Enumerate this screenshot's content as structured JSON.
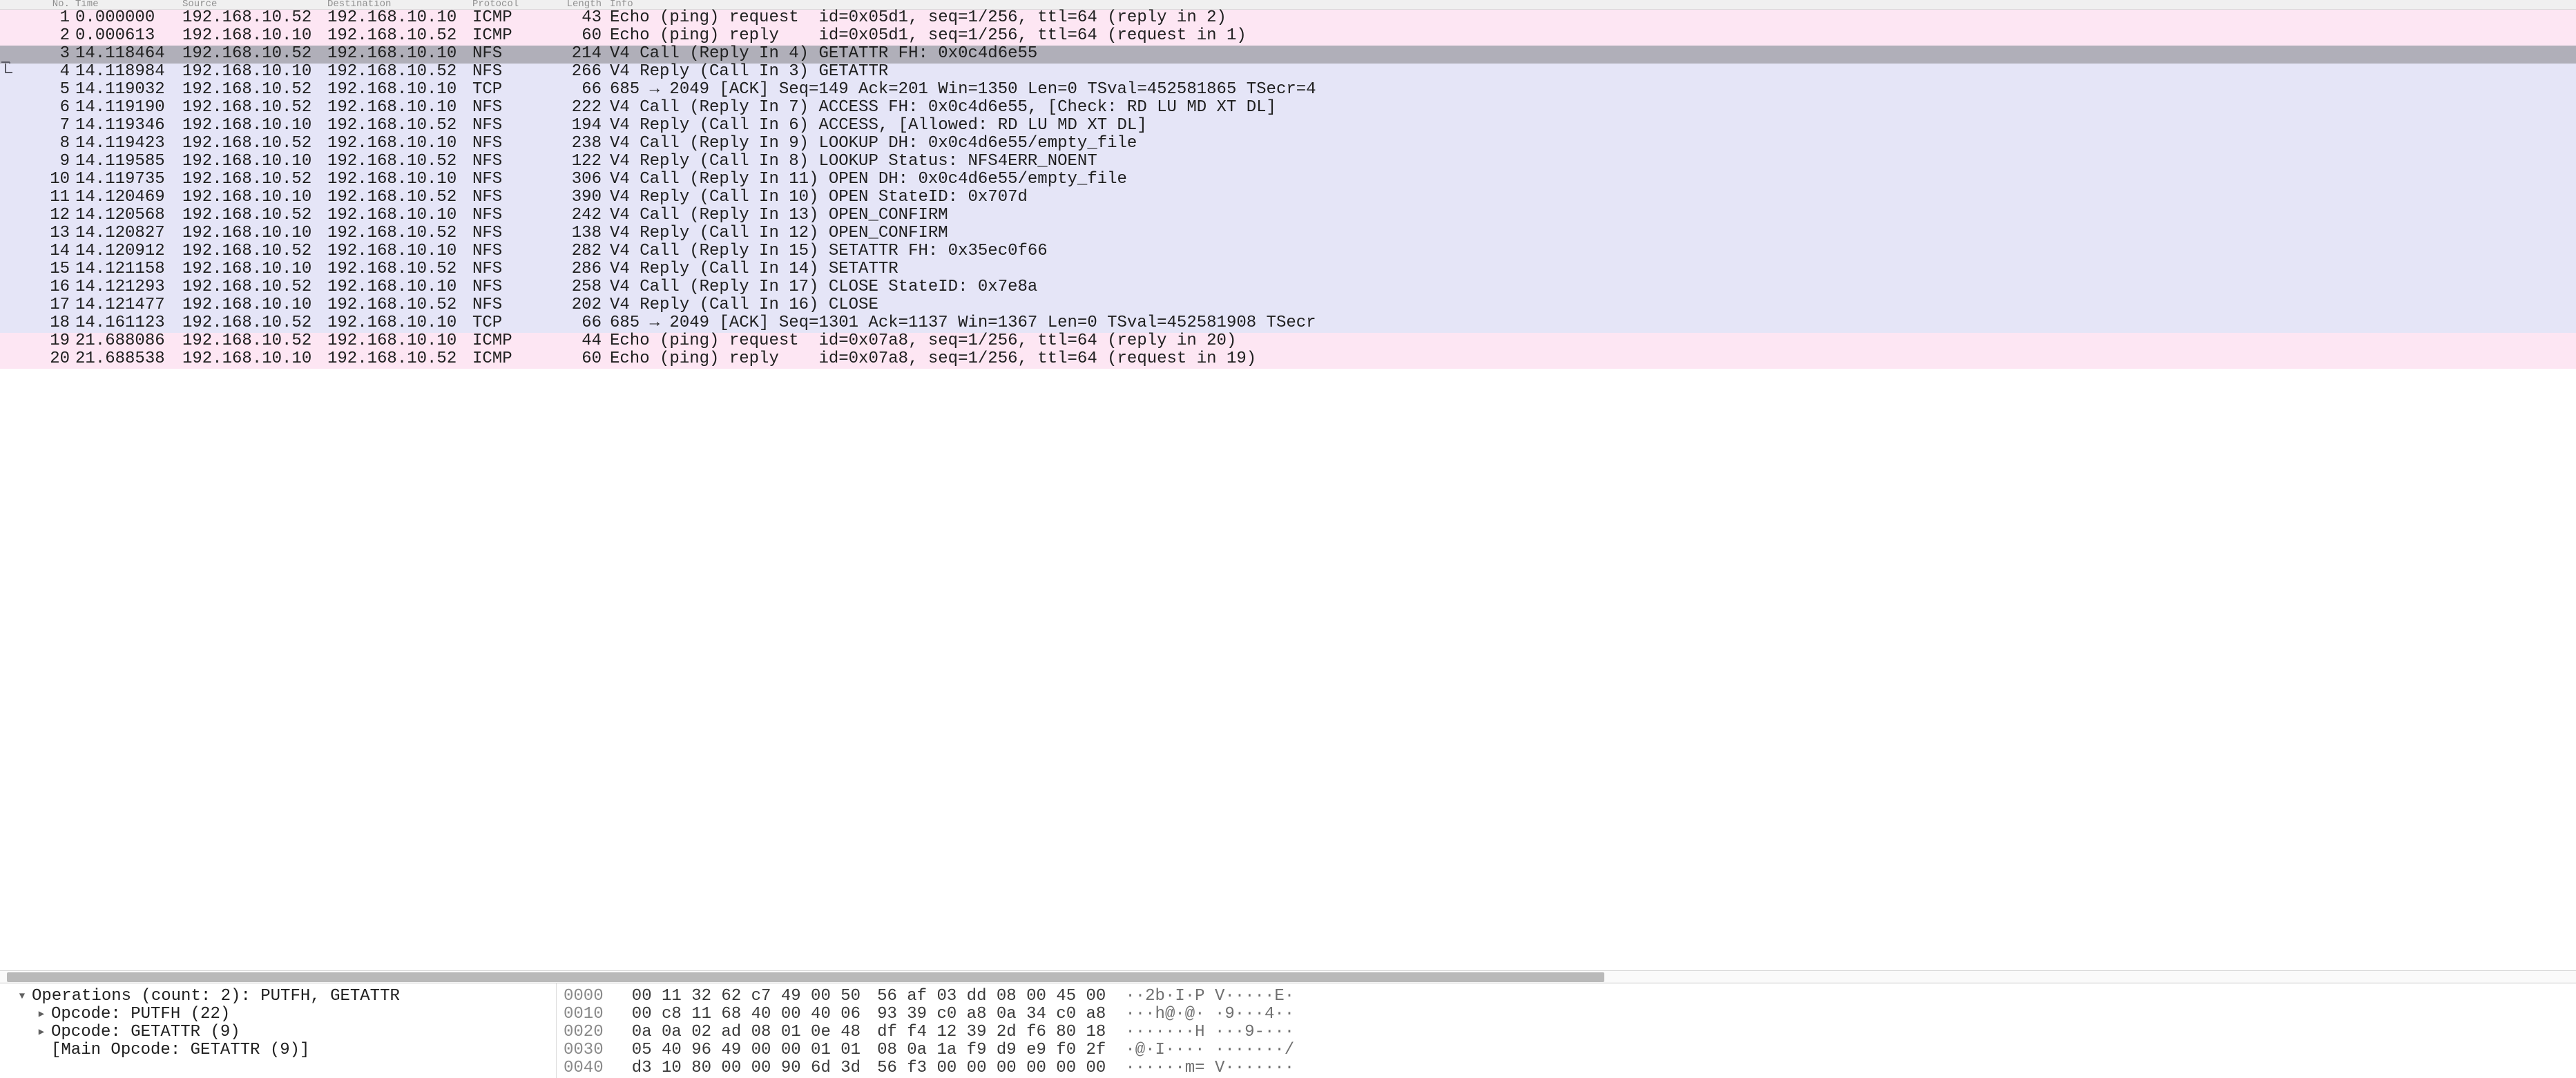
{
  "headers": {
    "no": "No.",
    "time": "Time",
    "source": "Source",
    "destination": "Destination",
    "protocol": "Protocol",
    "length": "Length",
    "info": "Info"
  },
  "selected_index": 2,
  "related_range_start": 3,
  "related_range_end": 17,
  "packets": [
    {
      "no": "1",
      "time": "0.000000",
      "src": "192.168.10.52",
      "dst": "192.168.10.10",
      "proto": "ICMP",
      "len": "43",
      "info": "Echo (ping) request  id=0x05d1, seq=1/256, ttl=64 (reply in 2)"
    },
    {
      "no": "2",
      "time": "0.000613",
      "src": "192.168.10.10",
      "dst": "192.168.10.52",
      "proto": "ICMP",
      "len": "60",
      "info": "Echo (ping) reply    id=0x05d1, seq=1/256, ttl=64 (request in 1)"
    },
    {
      "no": "3",
      "time": "14.118464",
      "src": "192.168.10.52",
      "dst": "192.168.10.10",
      "proto": "NFS",
      "len": "214",
      "info": "V4 Call (Reply In 4) GETATTR FH: 0x0c4d6e55"
    },
    {
      "no": "4",
      "time": "14.118984",
      "src": "192.168.10.10",
      "dst": "192.168.10.52",
      "proto": "NFS",
      "len": "266",
      "info": "V4 Reply (Call In 3) GETATTR"
    },
    {
      "no": "5",
      "time": "14.119032",
      "src": "192.168.10.52",
      "dst": "192.168.10.10",
      "proto": "TCP",
      "len": "66",
      "info": "685 → 2049 [ACK] Seq=149 Ack=201 Win=1350 Len=0 TSval=452581865 TSecr=4"
    },
    {
      "no": "6",
      "time": "14.119190",
      "src": "192.168.10.52",
      "dst": "192.168.10.10",
      "proto": "NFS",
      "len": "222",
      "info": "V4 Call (Reply In 7) ACCESS FH: 0x0c4d6e55, [Check: RD LU MD XT DL]"
    },
    {
      "no": "7",
      "time": "14.119346",
      "src": "192.168.10.10",
      "dst": "192.168.10.52",
      "proto": "NFS",
      "len": "194",
      "info": "V4 Reply (Call In 6) ACCESS, [Allowed: RD LU MD XT DL]"
    },
    {
      "no": "8",
      "time": "14.119423",
      "src": "192.168.10.52",
      "dst": "192.168.10.10",
      "proto": "NFS",
      "len": "238",
      "info": "V4 Call (Reply In 9) LOOKUP DH: 0x0c4d6e55/empty_file"
    },
    {
      "no": "9",
      "time": "14.119585",
      "src": "192.168.10.10",
      "dst": "192.168.10.52",
      "proto": "NFS",
      "len": "122",
      "info": "V4 Reply (Call In 8) LOOKUP Status: NFS4ERR_NOENT"
    },
    {
      "no": "10",
      "time": "14.119735",
      "src": "192.168.10.52",
      "dst": "192.168.10.10",
      "proto": "NFS",
      "len": "306",
      "info": "V4 Call (Reply In 11) OPEN DH: 0x0c4d6e55/empty_file"
    },
    {
      "no": "11",
      "time": "14.120469",
      "src": "192.168.10.10",
      "dst": "192.168.10.52",
      "proto": "NFS",
      "len": "390",
      "info": "V4 Reply (Call In 10) OPEN StateID: 0x707d"
    },
    {
      "no": "12",
      "time": "14.120568",
      "src": "192.168.10.52",
      "dst": "192.168.10.10",
      "proto": "NFS",
      "len": "242",
      "info": "V4 Call (Reply In 13) OPEN_CONFIRM"
    },
    {
      "no": "13",
      "time": "14.120827",
      "src": "192.168.10.10",
      "dst": "192.168.10.52",
      "proto": "NFS",
      "len": "138",
      "info": "V4 Reply (Call In 12) OPEN_CONFIRM"
    },
    {
      "no": "14",
      "time": "14.120912",
      "src": "192.168.10.52",
      "dst": "192.168.10.10",
      "proto": "NFS",
      "len": "282",
      "info": "V4 Call (Reply In 15) SETATTR FH: 0x35ec0f66"
    },
    {
      "no": "15",
      "time": "14.121158",
      "src": "192.168.10.10",
      "dst": "192.168.10.52",
      "proto": "NFS",
      "len": "286",
      "info": "V4 Reply (Call In 14) SETATTR"
    },
    {
      "no": "16",
      "time": "14.121293",
      "src": "192.168.10.52",
      "dst": "192.168.10.10",
      "proto": "NFS",
      "len": "258",
      "info": "V4 Call (Reply In 17) CLOSE StateID: 0x7e8a"
    },
    {
      "no": "17",
      "time": "14.121477",
      "src": "192.168.10.10",
      "dst": "192.168.10.52",
      "proto": "NFS",
      "len": "202",
      "info": "V4 Reply (Call In 16) CLOSE"
    },
    {
      "no": "18",
      "time": "14.161123",
      "src": "192.168.10.52",
      "dst": "192.168.10.10",
      "proto": "TCP",
      "len": "66",
      "info": "685 → 2049 [ACK] Seq=1301 Ack=1137 Win=1367 Len=0 TSval=452581908 TSecr"
    },
    {
      "no": "19",
      "time": "21.688086",
      "src": "192.168.10.52",
      "dst": "192.168.10.10",
      "proto": "ICMP",
      "len": "44",
      "info": "Echo (ping) request  id=0x07a8, seq=1/256, ttl=64 (reply in 20)"
    },
    {
      "no": "20",
      "time": "21.688538",
      "src": "192.168.10.10",
      "dst": "192.168.10.52",
      "proto": "ICMP",
      "len": "60",
      "info": "Echo (ping) reply    id=0x07a8, seq=1/256, ttl=64 (request in 19)"
    }
  ],
  "tree": [
    {
      "indent": 0,
      "caret": "open",
      "text": "Operations (count: 2): PUTFH, GETATTR"
    },
    {
      "indent": 1,
      "caret": "closed",
      "text": "Opcode: PUTFH (22)"
    },
    {
      "indent": 1,
      "caret": "closed",
      "text": "Opcode: GETATTR (9)"
    },
    {
      "indent": 1,
      "caret": "none",
      "text": "[Main Opcode: GETATTR (9)]"
    }
  ],
  "hex": [
    {
      "off": "0000",
      "b1": "00 11 32 62 c7 49 00 50",
      "b2": "56 af 03 dd 08 00 45 00",
      "asc": "··2b·I·P V·····E·"
    },
    {
      "off": "0010",
      "b1": "00 c8 11 68 40 00 40 06",
      "b2": "93 39 c0 a8 0a 34 c0 a8",
      "asc": "···h@·@· ·9···4··"
    },
    {
      "off": "0020",
      "b1": "0a 0a 02 ad 08 01 0e 48",
      "b2": "df f4 12 39 2d f6 80 18",
      "asc": "·······H ···9-···"
    },
    {
      "off": "0030",
      "b1": "05 40 96 49 00 00 01 01",
      "b2": "08 0a 1a f9 d9 e9 f0 2f",
      "asc": "·@·I···· ·······/"
    },
    {
      "off": "0040",
      "b1": "d3 10 80 00 00 90 6d 3d",
      "b2": "56 f3 00 00 00 00 00 00",
      "asc": "······m= V·······"
    }
  ]
}
